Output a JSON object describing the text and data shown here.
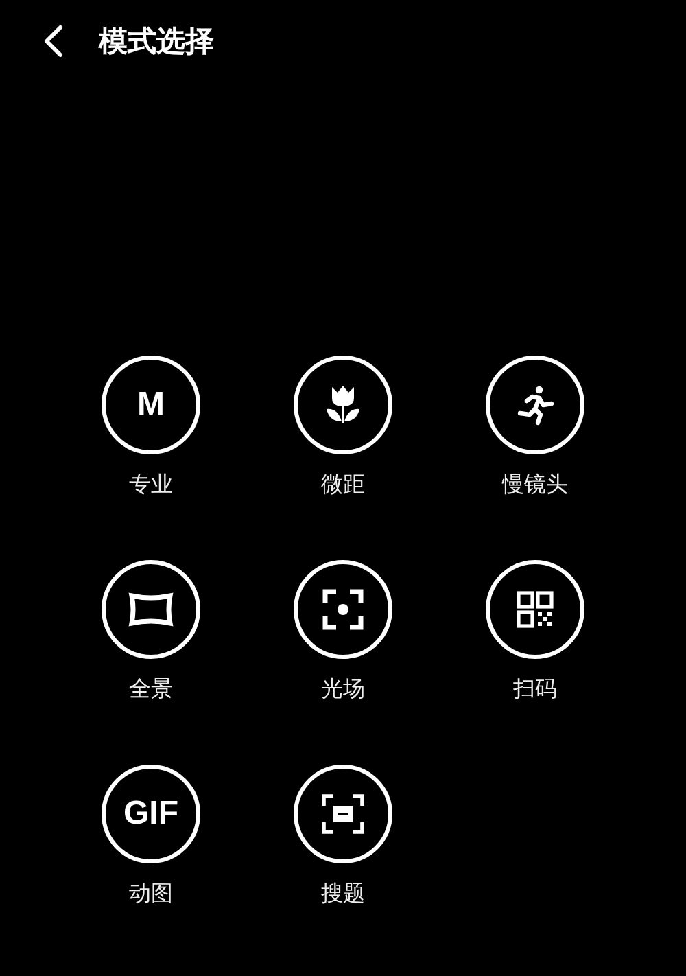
{
  "header": {
    "title": "模式选择"
  },
  "modes": [
    {
      "kind": "glyph",
      "glyph": "M",
      "label": "专业"
    },
    {
      "kind": "flower",
      "label": "微距"
    },
    {
      "kind": "runner",
      "label": "慢镜头"
    },
    {
      "kind": "panorama",
      "label": "全景"
    },
    {
      "kind": "focus",
      "label": "光场"
    },
    {
      "kind": "qr",
      "label": "扫码"
    },
    {
      "kind": "glyph",
      "glyph": "GIF",
      "label": "动图"
    },
    {
      "kind": "scan",
      "label": "搜题"
    }
  ]
}
